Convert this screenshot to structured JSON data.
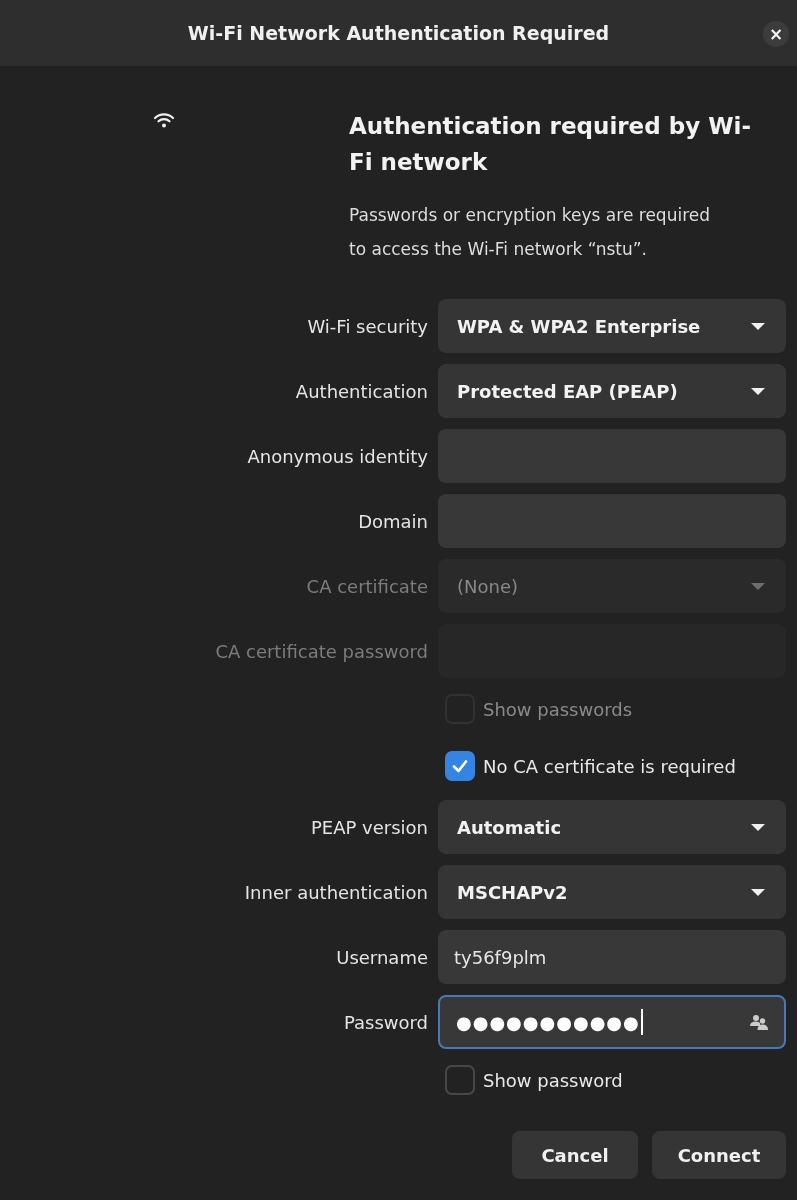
{
  "window": {
    "title": "Wi-Fi Network Authentication Required",
    "close": "×"
  },
  "heading": "Authentication required by Wi-Fi network",
  "description": "Passwords or encryption keys are required to access the Wi-Fi network “nstu”.",
  "rows": [
    {
      "kind": "dropdown",
      "label": "Wi-Fi security",
      "value": "WPA & WPA2 Enterprise",
      "disabled": false
    },
    {
      "kind": "dropdown",
      "label": "Authentication",
      "value": "Protected EAP (PEAP)",
      "disabled": false
    },
    {
      "kind": "entry",
      "label": "Anonymous identity",
      "disabled": false
    },
    {
      "kind": "entry",
      "label": "Domain",
      "disabled": false
    },
    {
      "kind": "dropdown",
      "label": "CA certificate",
      "value": "(None)",
      "disabled": true
    },
    {
      "kind": "entry",
      "label": "CA certificate password",
      "disabled": true
    },
    {
      "kind": "checkbox",
      "label": "Show passwords",
      "checked": false,
      "disabled": true
    },
    {
      "kind": "checkbox",
      "label": "No CA certificate is required",
      "checked": true,
      "disabled": false
    },
    {
      "kind": "dropdown",
      "label": "PEAP version",
      "value": "Automatic",
      "disabled": false
    },
    {
      "kind": "dropdown",
      "label": "Inner authentication",
      "value": "MSCHAPv2",
      "disabled": false
    },
    {
      "kind": "entry",
      "label": "Username",
      "value": "ty56f9plm",
      "disabled": false
    },
    {
      "kind": "password",
      "label": "Password",
      "value": "●●●●●●●●●●●",
      "disabled": false,
      "focused": true
    },
    {
      "kind": "checkbox",
      "label": "Show password",
      "checked": false,
      "disabled": false
    }
  ],
  "buttons": [
    "Cancel",
    "Connect"
  ]
}
